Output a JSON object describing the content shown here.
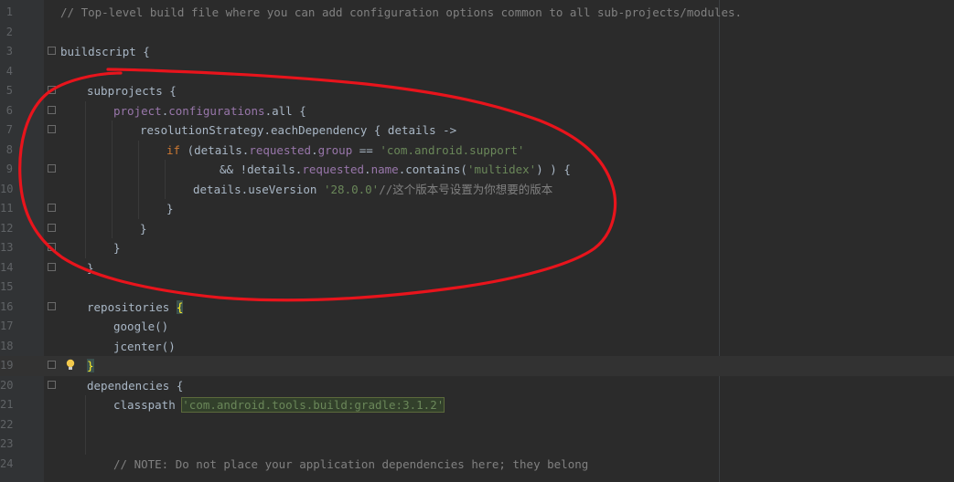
{
  "editor": {
    "lines": [
      {
        "num": "1",
        "indent": 0,
        "segs": [
          {
            "t": "// Top-level build file where you can add configuration options common to all sub-projects/modules.",
            "c": "cm"
          }
        ]
      },
      {
        "num": "2",
        "indent": 0,
        "segs": []
      },
      {
        "num": "3",
        "indent": 0,
        "fold": "box",
        "segs": [
          {
            "t": "buildscript {",
            "c": ""
          }
        ]
      },
      {
        "num": "4",
        "indent": 0,
        "segs": []
      },
      {
        "num": "5",
        "indent": 1,
        "fold": "box",
        "segs": [
          {
            "t": "subprojects {",
            "c": ""
          }
        ]
      },
      {
        "num": "6",
        "indent": 2,
        "fold": "box",
        "segs": [
          {
            "t": "project",
            "c": "prop"
          },
          {
            "t": ".",
            "c": ""
          },
          {
            "t": "configurations",
            "c": "prop"
          },
          {
            "t": ".all {",
            "c": ""
          }
        ]
      },
      {
        "num": "7",
        "indent": 3,
        "fold": "box",
        "segs": [
          {
            "t": "resolutionStrategy.",
            "c": ""
          },
          {
            "t": "eachDependency",
            "c": ""
          },
          {
            "t": " { details ->",
            "c": ""
          }
        ]
      },
      {
        "num": "8",
        "indent": 4,
        "segs": [
          {
            "t": "if",
            "c": "kw"
          },
          {
            "t": " (details.",
            "c": ""
          },
          {
            "t": "requested",
            "c": "prop"
          },
          {
            "t": ".",
            "c": ""
          },
          {
            "t": "group",
            "c": "prop"
          },
          {
            "t": " == ",
            "c": ""
          },
          {
            "t": "'com.android.support'",
            "c": "str"
          }
        ]
      },
      {
        "num": "9",
        "indent": 6,
        "fold": "box",
        "segs": [
          {
            "t": "&& !details.",
            "c": ""
          },
          {
            "t": "requested",
            "c": "prop"
          },
          {
            "t": ".",
            "c": ""
          },
          {
            "t": "name",
            "c": "prop"
          },
          {
            "t": ".contains(",
            "c": ""
          },
          {
            "t": "'multidex'",
            "c": "str"
          },
          {
            "t": ") ) {",
            "c": ""
          }
        ]
      },
      {
        "num": "10",
        "indent": 5,
        "segs": [
          {
            "t": "details.useVersion ",
            "c": ""
          },
          {
            "t": "'28.0.0'",
            "c": "str"
          },
          {
            "t": "//这个版本号设置为你想要的版本",
            "c": "cm"
          }
        ]
      },
      {
        "num": "11",
        "indent": 4,
        "fold": "end",
        "segs": [
          {
            "t": "}",
            "c": ""
          }
        ]
      },
      {
        "num": "12",
        "indent": 3,
        "fold": "end",
        "segs": [
          {
            "t": "}",
            "c": ""
          }
        ]
      },
      {
        "num": "13",
        "indent": 2,
        "fold": "end",
        "segs": [
          {
            "t": "}",
            "c": ""
          }
        ]
      },
      {
        "num": "14",
        "indent": 1,
        "fold": "end",
        "segs": [
          {
            "t": "}",
            "c": ""
          }
        ]
      },
      {
        "num": "15",
        "indent": 0,
        "segs": []
      },
      {
        "num": "16",
        "indent": 1,
        "fold": "box",
        "segs": [
          {
            "t": "repositories ",
            "c": ""
          },
          {
            "t": "{",
            "c": "brhl"
          }
        ]
      },
      {
        "num": "17",
        "indent": 2,
        "segs": [
          {
            "t": "google()",
            "c": ""
          }
        ]
      },
      {
        "num": "18",
        "indent": 2,
        "segs": [
          {
            "t": "jcenter()",
            "c": ""
          }
        ]
      },
      {
        "num": "19",
        "indent": 1,
        "fold": "end",
        "caret": true,
        "bulb": true,
        "segs": [
          {
            "t": "}",
            "c": "brhl"
          }
        ]
      },
      {
        "num": "20",
        "indent": 1,
        "fold": "box",
        "segs": [
          {
            "t": "dependencies {",
            "c": ""
          }
        ]
      },
      {
        "num": "21",
        "indent": 2,
        "segs": [
          {
            "t": "classpath ",
            "c": ""
          },
          {
            "t": "'com.android.tools.build:gradle:3.1.2'",
            "c": "strhl"
          }
        ]
      },
      {
        "num": "22",
        "indent": 0,
        "segs": []
      },
      {
        "num": "23",
        "indent": 0,
        "segs": []
      },
      {
        "num": "24",
        "indent": 2,
        "segs": [
          {
            "t": "// NOTE: Do not place your application dependencies here; they belong",
            "c": "cm"
          }
        ]
      }
    ]
  },
  "colors": {
    "background": "#2b2b2b",
    "gutter": "#313335",
    "annotation": "#e8141c"
  },
  "icons": {
    "fold": "fold-marker-icon",
    "bulb": "lightbulb-icon"
  }
}
